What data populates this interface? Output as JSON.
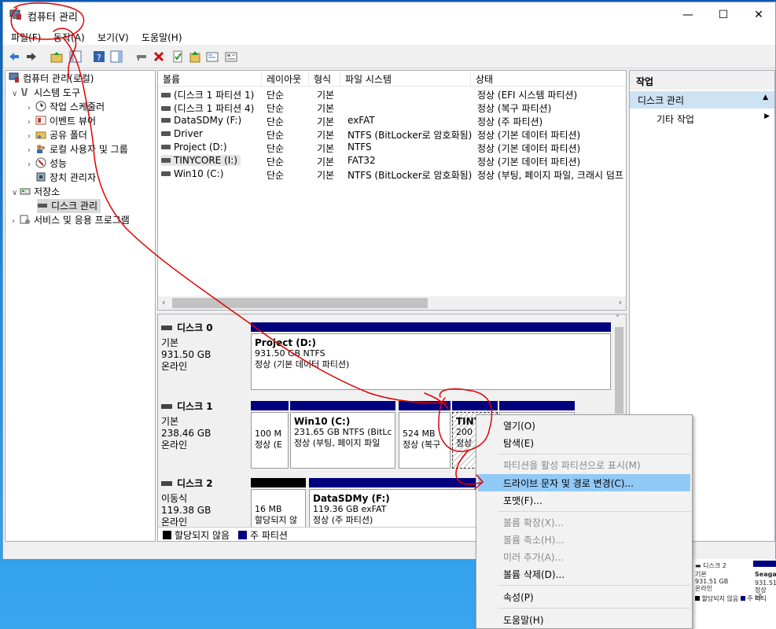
{
  "window": {
    "title": "컴퓨터 관리",
    "minimize": "—",
    "maximize": "☐",
    "close": "✕"
  },
  "menu": [
    "파일(F)",
    "동작(A)",
    "보기(V)",
    "도움말(H)"
  ],
  "tree": {
    "root": "컴퓨터 관리(로컬)",
    "system_tools": "시스템 도구",
    "task_scheduler": "작업 스케줄러",
    "event_viewer": "이벤트 뷰어",
    "shared_folders": "공유 폴더",
    "local_users": "로컬 사용자 및 그룹",
    "performance": "성능",
    "device_manager": "장치 관리자",
    "storage": "저장소",
    "disk_management": "디스크 관리",
    "services": "서비스 및 응용 프로그램"
  },
  "volumes": {
    "headers": [
      "볼륨",
      "레이아웃",
      "형식",
      "파일 시스템",
      "상태"
    ],
    "rows": [
      [
        "(디스크 1 파티션 1)",
        "단순",
        "기본",
        "",
        "정상 (EFI 시스템 파티션)"
      ],
      [
        "(디스크 1 파티션 4)",
        "단순",
        "기본",
        "",
        "정상 (복구 파티션)"
      ],
      [
        "DataSDMy (F:)",
        "단순",
        "기본",
        "exFAT",
        "정상 (주 파티션)"
      ],
      [
        "Driver",
        "단순",
        "기본",
        "NTFS (BitLocker로 암호화됨)",
        "정상 (기본 데이터 파티션)"
      ],
      [
        "Project (D:)",
        "단순",
        "기본",
        "NTFS",
        "정상 (기본 데이터 파티션)"
      ],
      [
        "TINYCORE (I:)",
        "단순",
        "기본",
        "FAT32",
        "정상 (기본 데이터 파티션)"
      ],
      [
        "Win10 (C:)",
        "단순",
        "기본",
        "NTFS (BitLocker로 암호화됨)",
        "정상 (부팅, 페이지 파일, 크래시 덤프"
      ]
    ]
  },
  "disks": {
    "d0": {
      "name": "디스크 0",
      "type": "기본",
      "size": "931.50 GB",
      "status": "온라인",
      "p1_name": "Project  (D:)",
      "p1_size": "931.50 GB NTFS",
      "p1_status": "정상 (기본 데이터 파티션)"
    },
    "d1": {
      "name": "디스크 1",
      "type": "기본",
      "size": "238.46 GB",
      "status": "온라인",
      "p1_size": "100 M",
      "p1_status": "정상 (E",
      "p2_name": "Win10  (C:)",
      "p2_size": "231.65 GB NTFS (BitLc",
      "p2_status": "정상 (부팅, 페이지 파일",
      "p3_size": "524 MB",
      "p3_status": "정상 (복구",
      "p4_name": "TINY",
      "p4_size": "200",
      "p4_status": "정상"
    },
    "d2": {
      "name": "디스크 2",
      "type": "이동식",
      "size": "119.38 GB",
      "status": "온라인",
      "p1_size": "16 MB",
      "p1_status": "할당되지 않",
      "p2_name": "DataSDMy  (F:)",
      "p2_size": "119.36 GB exFAT",
      "p2_status": "정상 (주 파티션)"
    }
  },
  "legend": {
    "unallocated": "할당되지 않음",
    "primary": "주 파티션"
  },
  "actions": {
    "header": "작업",
    "selected": "디스크 관리",
    "more": "기타 작업"
  },
  "context": {
    "open": "열기(O)",
    "explore": "탐색(E)",
    "mark_active": "파티션을 활성 파티션으로 표시(M)",
    "change_letter": "드라이브 문자 및 경로 변경(C)...",
    "format": "포맷(F)...",
    "extend": "볼륨 확장(X)...",
    "shrink": "볼륨 축소(H)...",
    "mirror": "미러 추가(A)...",
    "delete": "볼륨 삭제(D)...",
    "properties": "속성(P)",
    "help": "도움말(H)"
  },
  "background": {
    "disk": "디스크 2",
    "type": "기본",
    "size": "931.51 GB",
    "status": "온라인",
    "vol": "Seaga",
    "vol_size": "931.51",
    "vol_status": "정상 (주",
    "legend": "할당되지 않음",
    "legend2": "주 파티"
  },
  "colors": {
    "primary": "#00007f",
    "highlight": "#91c9f7",
    "annotation": "#e00000"
  }
}
